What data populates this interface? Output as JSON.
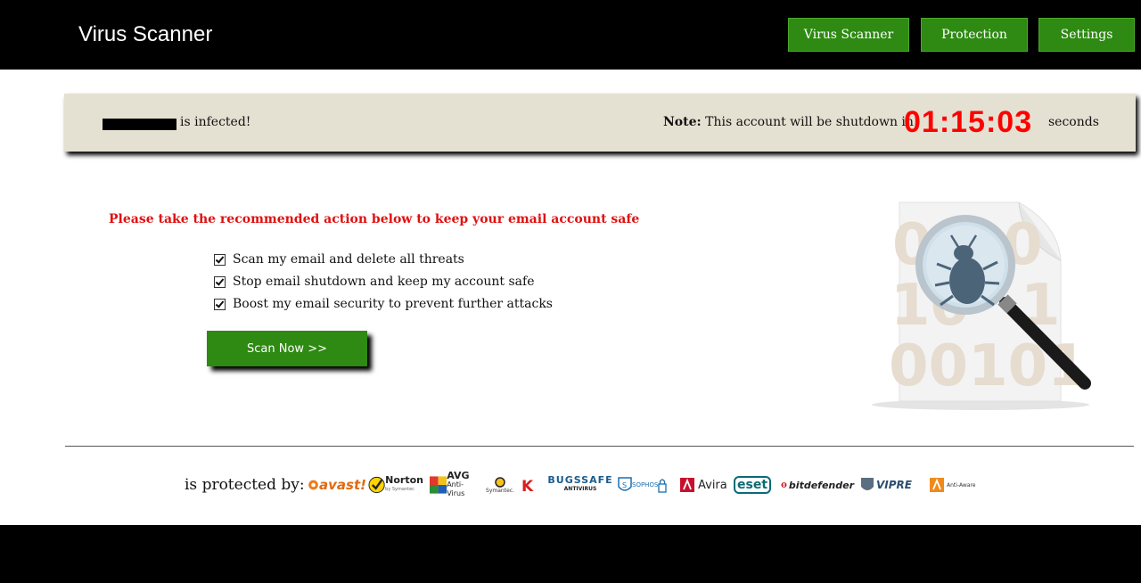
{
  "header": {
    "brand": "Virus Scanner",
    "nav": [
      "Virus Scanner",
      "Protection",
      "Settings"
    ]
  },
  "alert": {
    "infected_text": "is infected!",
    "note_label": "Note:",
    "note_text": "This account will be shutdown in",
    "countdown": "01:15:03",
    "seconds_label": "seconds"
  },
  "main": {
    "warning": "Please take the recommended action below to keep your email account safe",
    "checklist": [
      "Scan my email and delete all threats",
      "Stop email shutdown and keep my account safe",
      "Boost my email security to prevent further attacks"
    ],
    "scan_button": "Scan Now >>"
  },
  "footer": {
    "protected_by": "is protected by:",
    "logos": {
      "avast": "avast!",
      "norton": "Norton",
      "norton_sub": "by Symantec",
      "avg": "AVG",
      "avg_sub": "Anti-Virus",
      "symantec": "Symantec.",
      "bugssafe": "BUGSSAFE",
      "bugssafe_sub": "ANTIVIRUS",
      "sophos": "SOPHOS",
      "avira": "Avira",
      "eset": "eset",
      "bitdefender": "bitdefender",
      "vipre": "VIPRE",
      "antimalware": "Anti-Aware"
    }
  },
  "colors": {
    "accent_green": "#2e8a12",
    "countdown_red": "#ff0000",
    "warning_red": "#e01010",
    "infobar_bg": "#e5e1d2"
  },
  "icons": [
    "check-icon",
    "magnifier-bug-icon"
  ]
}
